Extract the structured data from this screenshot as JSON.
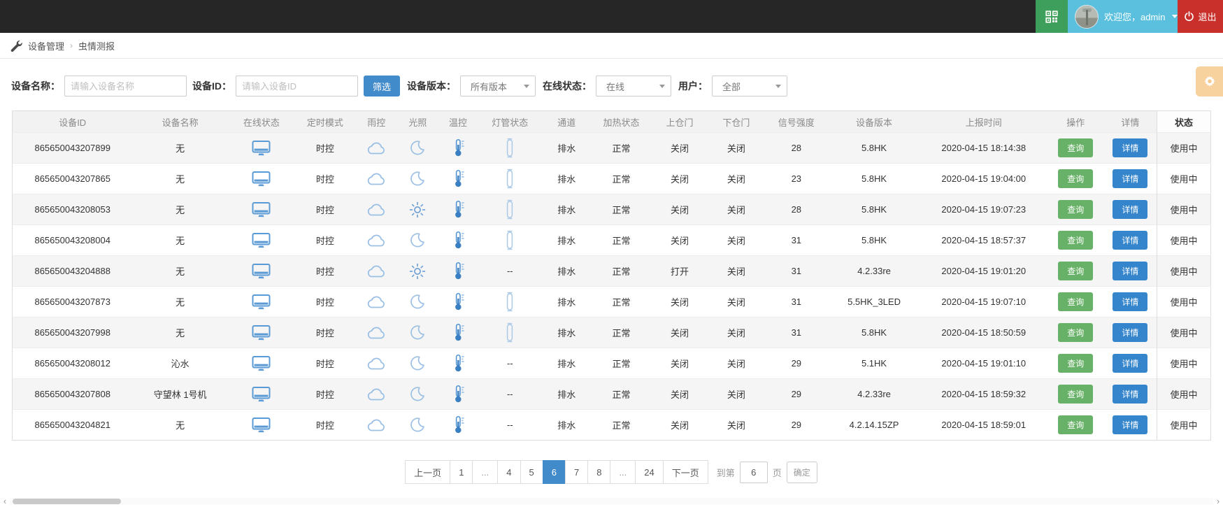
{
  "topbar": {
    "qr_button": {
      "icon": "qr-code-icon"
    },
    "user": {
      "greeting": "欢迎您，",
      "username": "admin",
      "avatar_icon": "avatar-photo",
      "dropdown_icon": "chevron-down-icon"
    },
    "logout": {
      "label": "退出",
      "icon": "power-icon"
    }
  },
  "breadcrumb": {
    "icon": "wrench-icon",
    "items": [
      "设备管理",
      "虫情测报"
    ],
    "separator": "›"
  },
  "filters": {
    "device_name": {
      "label": "设备名称：",
      "placeholder": "请输入设备名称",
      "value": ""
    },
    "device_id": {
      "label": "设备ID：",
      "placeholder": "请输入设备ID",
      "value": ""
    },
    "filter_button": "筛选",
    "device_version": {
      "label": "设备版本：",
      "value": "所有版本"
    },
    "online_status": {
      "label": "在线状态：",
      "value": "在线"
    },
    "user": {
      "label": "用户：",
      "value": "全部"
    },
    "settings_button_icon": "gear-icon"
  },
  "table": {
    "columns": [
      "设备ID",
      "设备名称",
      "在线状态",
      "定时模式",
      "雨控",
      "光照",
      "温控",
      "灯管状态",
      "通道",
      "加热状态",
      "上仓门",
      "下仓门",
      "信号强度",
      "设备版本",
      "上报时间",
      "操作",
      "详情",
      "状态"
    ],
    "action_labels": {
      "query": "查询",
      "detail": "详情"
    },
    "rows": [
      {
        "device_id": "865650043207899",
        "name": "无",
        "online": "monitor-icon",
        "timer_mode": "时控",
        "rain": "cloud-icon",
        "light": "moon-icon",
        "temp": "thermometer-icon",
        "lamp": "tube-icon",
        "channel": "排水",
        "heating": "正常",
        "upper_door": "关闭",
        "lower_door": "关闭",
        "signal": "28",
        "version": "5.8HK",
        "report_time": "2020-04-15 18:14:38",
        "status": "使用中"
      },
      {
        "device_id": "865650043207865",
        "name": "无",
        "online": "monitor-icon",
        "timer_mode": "时控",
        "rain": "cloud-icon",
        "light": "moon-icon",
        "temp": "thermometer-icon",
        "lamp": "tube-icon",
        "channel": "排水",
        "heating": "正常",
        "upper_door": "关闭",
        "lower_door": "关闭",
        "signal": "23",
        "version": "5.8HK",
        "report_time": "2020-04-15 19:04:00",
        "status": "使用中"
      },
      {
        "device_id": "865650043208053",
        "name": "无",
        "online": "monitor-icon",
        "timer_mode": "时控",
        "rain": "cloud-icon",
        "light": "sun-icon",
        "temp": "thermometer-icon",
        "lamp": "tube-icon",
        "channel": "排水",
        "heating": "正常",
        "upper_door": "关闭",
        "lower_door": "关闭",
        "signal": "28",
        "version": "5.8HK",
        "report_time": "2020-04-15 19:07:23",
        "status": "使用中"
      },
      {
        "device_id": "865650043208004",
        "name": "无",
        "online": "monitor-icon",
        "timer_mode": "时控",
        "rain": "cloud-icon",
        "light": "moon-icon",
        "temp": "thermometer-icon",
        "lamp": "tube-icon",
        "channel": "排水",
        "heating": "正常",
        "upper_door": "关闭",
        "lower_door": "关闭",
        "signal": "31",
        "version": "5.8HK",
        "report_time": "2020-04-15 18:57:37",
        "status": "使用中"
      },
      {
        "device_id": "865650043204888",
        "name": "无",
        "online": "monitor-icon",
        "timer_mode": "时控",
        "rain": "cloud-icon",
        "light": "sun-icon",
        "temp": "thermometer-icon",
        "lamp": "--",
        "channel": "排水",
        "heating": "正常",
        "upper_door": "打开",
        "lower_door": "关闭",
        "signal": "31",
        "version": "4.2.33re",
        "report_time": "2020-04-15 19:01:20",
        "status": "使用中"
      },
      {
        "device_id": "865650043207873",
        "name": "无",
        "online": "monitor-icon",
        "timer_mode": "时控",
        "rain": "cloud-icon",
        "light": "moon-icon",
        "temp": "thermometer-icon",
        "lamp": "tube-icon",
        "channel": "排水",
        "heating": "正常",
        "upper_door": "关闭",
        "lower_door": "关闭",
        "signal": "31",
        "version": "5.5HK_3LED",
        "report_time": "2020-04-15 19:07:10",
        "status": "使用中"
      },
      {
        "device_id": "865650043207998",
        "name": "无",
        "online": "monitor-icon",
        "timer_mode": "时控",
        "rain": "cloud-icon",
        "light": "moon-icon",
        "temp": "thermometer-icon",
        "lamp": "tube-icon",
        "channel": "排水",
        "heating": "正常",
        "upper_door": "关闭",
        "lower_door": "关闭",
        "signal": "31",
        "version": "5.8HK",
        "report_time": "2020-04-15 18:50:59",
        "status": "使用中"
      },
      {
        "device_id": "865650043208012",
        "name": "沁水",
        "online": "monitor-icon",
        "timer_mode": "时控",
        "rain": "cloud-icon",
        "light": "moon-icon",
        "temp": "thermometer-icon",
        "lamp": "--",
        "channel": "排水",
        "heating": "正常",
        "upper_door": "关闭",
        "lower_door": "关闭",
        "signal": "29",
        "version": "5.1HK",
        "report_time": "2020-04-15 19:01:10",
        "status": "使用中"
      },
      {
        "device_id": "865650043207808",
        "name": "守望林 1号机",
        "online": "monitor-icon",
        "timer_mode": "时控",
        "rain": "cloud-icon",
        "light": "moon-icon",
        "temp": "thermometer-icon",
        "lamp": "--",
        "channel": "排水",
        "heating": "正常",
        "upper_door": "关闭",
        "lower_door": "关闭",
        "signal": "29",
        "version": "4.2.33re",
        "report_time": "2020-04-15 18:59:32",
        "status": "使用中"
      },
      {
        "device_id": "865650043204821",
        "name": "无",
        "online": "monitor-icon",
        "timer_mode": "时控",
        "rain": "cloud-icon",
        "light": "moon-icon",
        "temp": "thermometer-icon",
        "lamp": "--",
        "channel": "排水",
        "heating": "正常",
        "upper_door": "关闭",
        "lower_door": "关闭",
        "signal": "29",
        "version": "4.2.14.15ZP",
        "report_time": "2020-04-15 18:59:01",
        "status": "使用中"
      }
    ]
  },
  "pagination": {
    "items": [
      {
        "label": "上一页"
      },
      {
        "label": "1"
      },
      {
        "label": "...",
        "ellipsis": true
      },
      {
        "label": "4"
      },
      {
        "label": "5"
      },
      {
        "label": "6",
        "active": true
      },
      {
        "label": "7"
      },
      {
        "label": "8"
      },
      {
        "label": "...",
        "ellipsis": true
      },
      {
        "label": "24"
      },
      {
        "label": "下一页"
      }
    ],
    "goto": {
      "prefix": "到第",
      "value": "6",
      "suffix": "页",
      "confirm": "确定"
    }
  },
  "scrollbar": {
    "left_arrow": "‹",
    "right_arrow": "›"
  },
  "colors": {
    "topbar_bg": "#262626",
    "qr_green": "#3e9e5b",
    "user_blue": "#5bc0de",
    "logout_red": "#c9302c",
    "filter_blue": "#428bca",
    "query_green": "#68b168",
    "detail_blue": "#3585cc",
    "active_page_blue": "#428bca",
    "settings_orange": "#f0ad4e",
    "icon_blue": "#5b9bd5"
  }
}
